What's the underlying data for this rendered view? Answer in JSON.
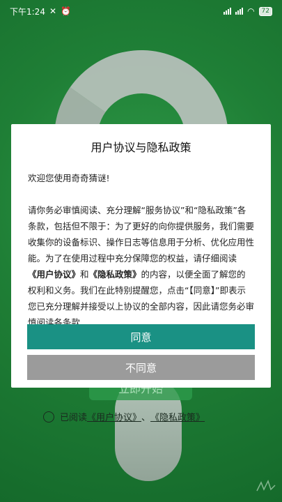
{
  "status_bar": {
    "time": "下午1:24",
    "battery": "72"
  },
  "background": {
    "start_button": "立即开始",
    "agree_prefix": "已阅读",
    "agree_link_user": "《用户协议》",
    "agree_separator": "、",
    "agree_link_privacy": "《隐私政策》"
  },
  "dialog": {
    "title": "用户协议与隐私政策",
    "greeting": "欢迎您使用奇奇猜谜!",
    "para_start": "请你务必审慎阅读、充分理解“服务协议”和“隐私政策”各条款，包括但不限于：为了更好的向你提供服务，我们需要收集你的设备标识、操作日志等信息用于分析、优化应用性能。为了在使用过程中充分保障您的权益，请仔细阅读",
    "link_user": "《用户协议》",
    "and": "和",
    "link_privacy": "《隐私政策》",
    "para_end": "的内容，以便全面了解您的权利和义务。我们在此特别提醒您，点击“【同意】”即表示您已充分理解并接受以上协议的全部内容，因此请您务必审慎阅读各条款",
    "agree_label": "同意",
    "disagree_label": "不同意"
  },
  "colors": {
    "background_green": "#1d7a35",
    "agree_button": "#1a9184",
    "disagree_button": "#9b9b9b"
  }
}
